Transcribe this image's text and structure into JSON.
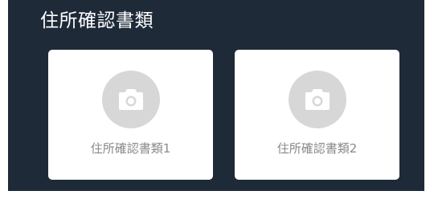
{
  "section": {
    "title": "住所確認書類"
  },
  "upload_cards": [
    {
      "label": "住所確認書類1",
      "icon": "camera-icon"
    },
    {
      "label": "住所確認書類2",
      "icon": "camera-icon"
    }
  ],
  "colors": {
    "panel_background": "#1e2a38",
    "card_background": "#ffffff",
    "icon_circle": "#d7d7d7",
    "label_text": "#8a8a8a"
  }
}
